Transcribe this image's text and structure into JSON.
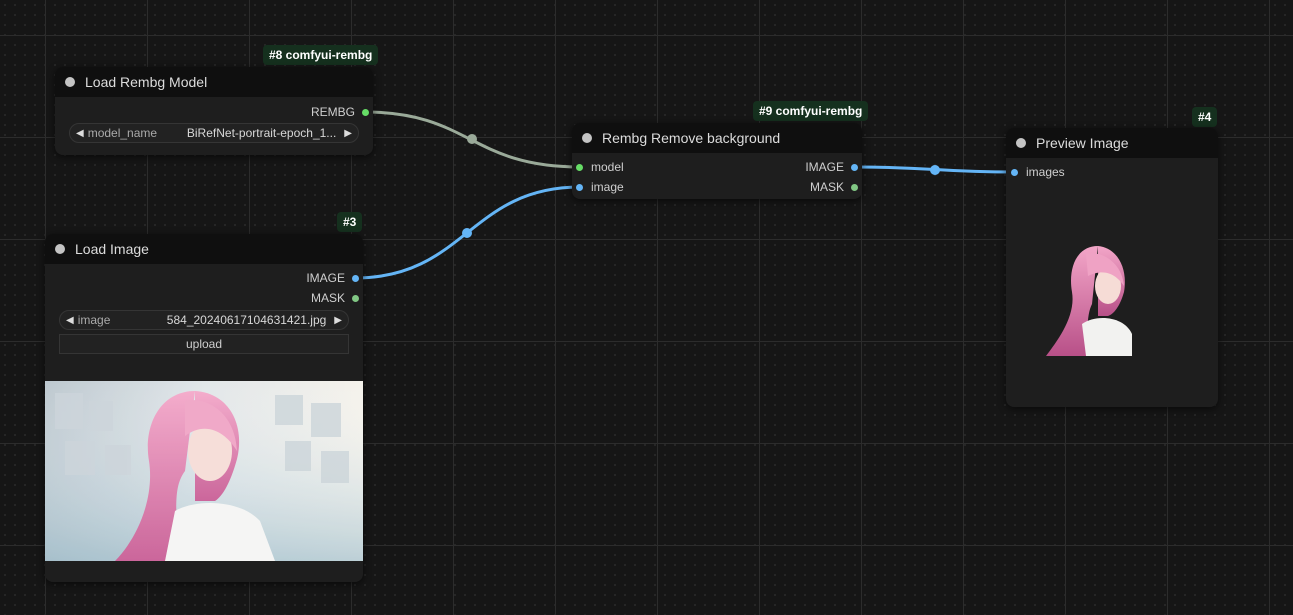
{
  "colors": {
    "model_wire": "#9aaa99",
    "image_wire": "#64b5f6",
    "image_slot": "#64b5f6",
    "mask_slot": "#81c784",
    "model_slot": "#66dd66",
    "badge_bg": "#15301e"
  },
  "nodes": {
    "load_rembg_model": {
      "title": "Load Rembg Model",
      "badge": "#8 comfyui-rembg",
      "output_rembg": "REMBG",
      "widget_label": "model_name",
      "widget_value": "BiRefNet-portrait-epoch_1..."
    },
    "load_image": {
      "title": "Load Image",
      "badge": "#3",
      "output_image": "IMAGE",
      "output_mask": "MASK",
      "widget_label": "image",
      "widget_value": "584_20240617104631421.jpg",
      "upload_label": "upload"
    },
    "rembg_remove_background": {
      "title": "Rembg Remove background",
      "badge": "#9 comfyui-rembg",
      "input_model": "model",
      "input_image": "image",
      "output_image": "IMAGE",
      "output_mask": "MASK"
    },
    "preview_image": {
      "title": "Preview Image",
      "badge": "#4",
      "input_images": "images"
    }
  }
}
